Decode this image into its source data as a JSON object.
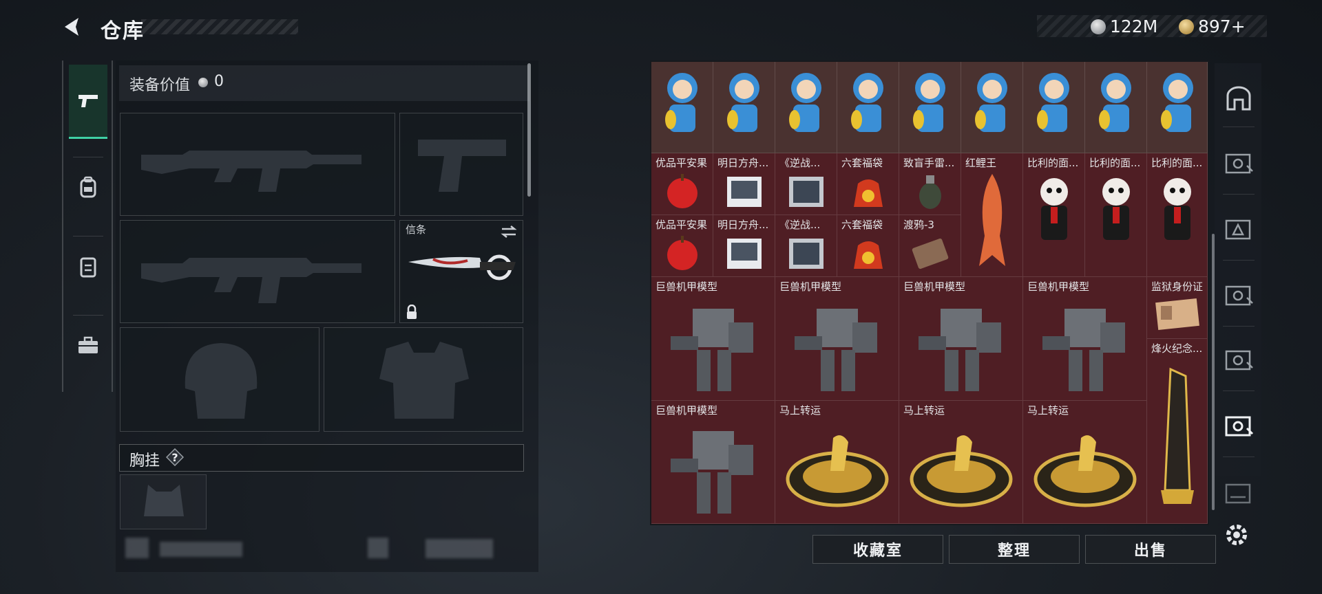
{
  "header": {
    "title": "仓库",
    "silver_amount": "122M",
    "gold_amount": "897+"
  },
  "equipment": {
    "value_label": "装备价值",
    "value_number": "0",
    "melee_slot_label": "信条",
    "chest_rig_label": "胸挂",
    "help_symbol": "?"
  },
  "inventory": {
    "row1": [
      "",
      "",
      "",
      "",
      "",
      "",
      "",
      "",
      ""
    ],
    "row2": [
      "优品平安果",
      "明日方舟...",
      "《逆战...",
      "六套福袋",
      "致盲手雷...",
      "红鲤王",
      "比利的面...",
      "比利的面...",
      "比利的面..."
    ],
    "row3": [
      "优品平安果",
      "明日方舟...",
      "《逆战...",
      "六套福袋",
      "渡鸦-3"
    ],
    "mech_label": "巨兽机甲模型",
    "fortune_label": "马上转运",
    "prison_id_label": "监狱身份证",
    "beacon_label": "烽火纪念..."
  },
  "actions": {
    "collection": "收藏室",
    "sort": "整理",
    "sell": "出售"
  },
  "colors": {
    "accent": "#3fd1a5",
    "cell_red": "#4f1e24",
    "cell_brown": "#4a3230"
  }
}
